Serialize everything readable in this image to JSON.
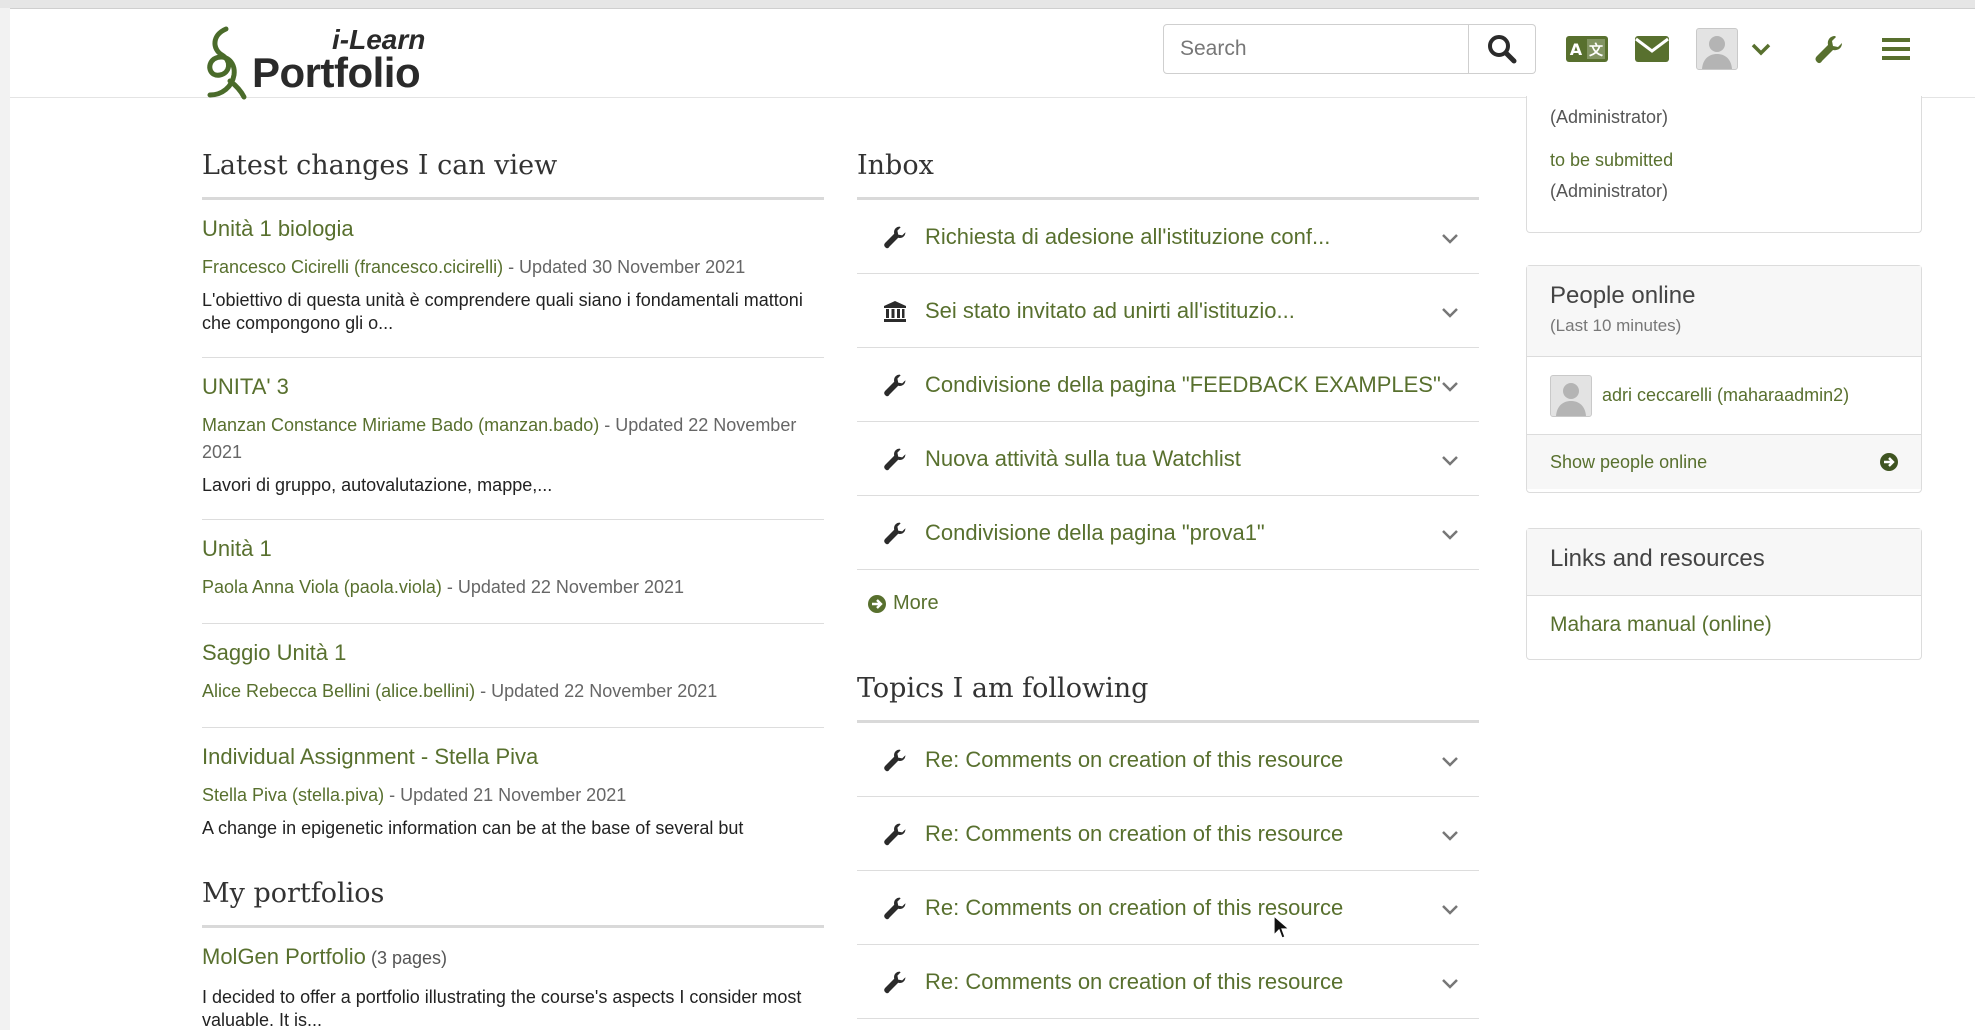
{
  "header": {
    "logo_top": "i-Learn",
    "logo_bottom": "Portfolio",
    "search_placeholder": "Search",
    "icons": [
      "search-icon",
      "language-icon",
      "mail-icon",
      "avatar",
      "chevron-down-icon",
      "wrench-icon",
      "menu-icon"
    ]
  },
  "latest_changes": {
    "title": "Latest changes I can view",
    "items": [
      {
        "title": "Unità 1 biologia",
        "author": "Francesco Cicirelli (francesco.cicirelli)",
        "updated": " - Updated 30 November 2021",
        "description": "L'obiettivo di questa unità è comprendere quali siano i fondamentali mattoni che compongono gli o..."
      },
      {
        "title": "UNITA' 3",
        "author": "Manzan Constance Miriame Bado (manzan.bado)",
        "updated": " - Updated 22 November 2021",
        "description": "Lavori di gruppo, autovalutazione, mappe,..."
      },
      {
        "title": "Unità 1",
        "author": "Paola Anna Viola (paola.viola)",
        "updated": " - Updated 22 November 2021",
        "description": ""
      },
      {
        "title": "Saggio Unità 1",
        "author": "Alice Rebecca Bellini (alice.bellini)",
        "updated": " - Updated 22 November 2021",
        "description": ""
      },
      {
        "title": "Individual Assignment - Stella Piva",
        "author": "Stella Piva (stella.piva)",
        "updated": " - Updated 21 November 2021",
        "description": "A change in epigenetic information can be at the base of several but infectious diseases. Goul"
      }
    ]
  },
  "my_portfolios": {
    "title": "My portfolios",
    "items": [
      {
        "title": "MolGen Portfolio",
        "pages": "(3 pages)",
        "description": "I decided to offer a portfolio illustrating the course's aspects I consider most valuable. It is..."
      }
    ]
  },
  "inbox": {
    "title": "Inbox",
    "items": [
      {
        "icon": "wrench-icon",
        "text": "Richiesta di adesione all'istituzione conf..."
      },
      {
        "icon": "institution-icon",
        "text": "Sei stato invitato ad unirti all'istituzio..."
      },
      {
        "icon": "wrench-icon",
        "text": "Condivisione della pagina \"FEEDBACK EXAMPLES\""
      },
      {
        "icon": "wrench-icon",
        "text": "Nuova attività sulla tua Watchlist"
      },
      {
        "icon": "wrench-icon",
        "text": "Condivisione della pagina \"prova1\""
      }
    ],
    "more_label": "More"
  },
  "topics": {
    "title": "Topics I am following",
    "items": [
      {
        "text": "Re: Comments on creation of this resource"
      },
      {
        "text": "Re: Comments on creation of this resource"
      },
      {
        "text": "Re: Comments on creation of this resource"
      },
      {
        "text": "Re: Comments on creation of this resource"
      }
    ]
  },
  "sidebar": {
    "partial": {
      "line1": "(Administrator)",
      "line2": "to be submitted",
      "line3": "(Administrator)"
    },
    "people_online": {
      "title": "People online",
      "subtitle": "(Last 10 minutes)",
      "users": [
        {
          "name": "adri ceccarelli (maharaadmin2)"
        }
      ],
      "show_label": "Show people online"
    },
    "links": {
      "title": "Links and resources",
      "items": [
        "Mahara manual (online)"
      ]
    }
  },
  "colors": {
    "brand_green": "#58702e",
    "border": "#dddddd",
    "heading": "#333333"
  }
}
